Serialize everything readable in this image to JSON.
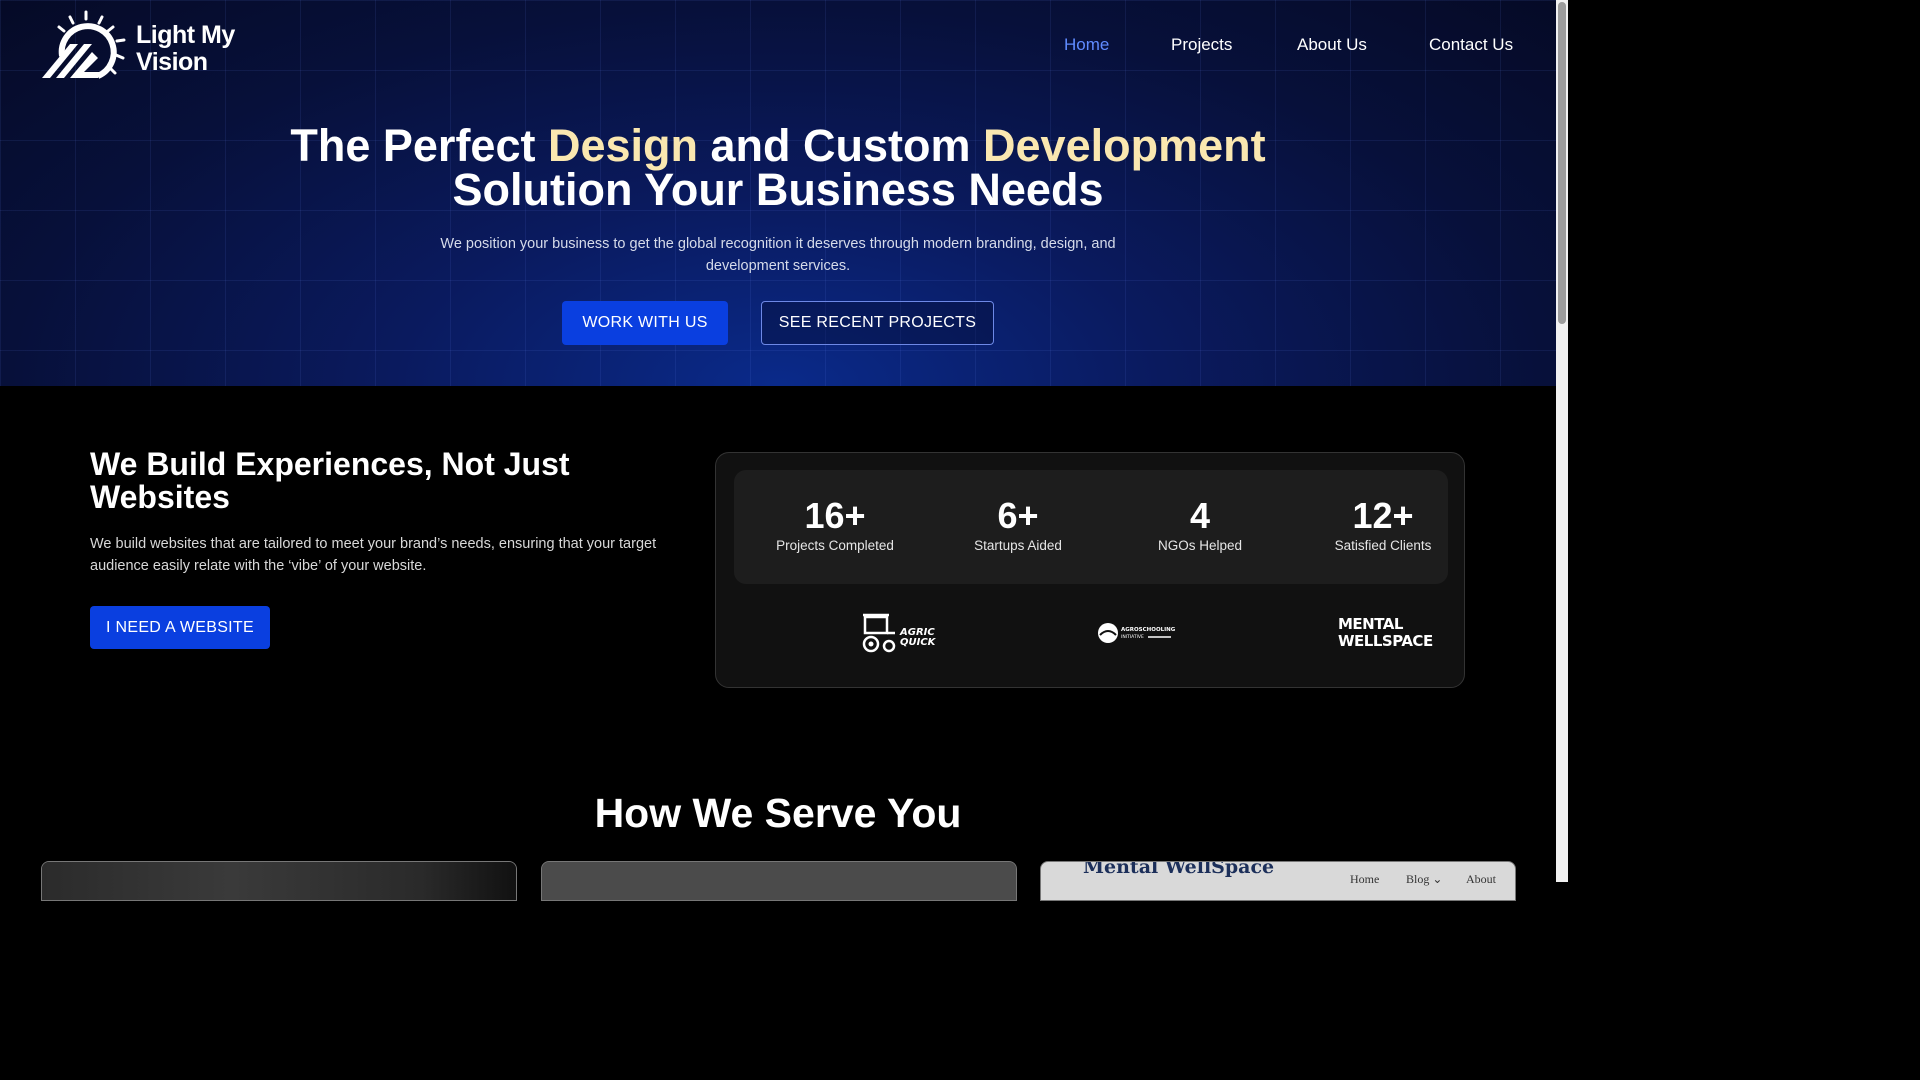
{
  "brand": {
    "line1": "Light My",
    "line2": "Vision"
  },
  "nav": [
    {
      "label": "Home",
      "active": true
    },
    {
      "label": "Projects",
      "active": false
    },
    {
      "label": "About Us",
      "active": false
    },
    {
      "label": "Contact Us",
      "active": false
    }
  ],
  "hero": {
    "title_a": "The Perfect ",
    "title_hl1": "Design",
    "title_b": " and Custom ",
    "title_hl2": "Development",
    "title_line2": "Solution Your Business Needs",
    "subtitle": "We position your business to get the global recognition it deserves through modern branding, design, and development services.",
    "primary_cta": "WORK WITH US",
    "secondary_cta": "SEE RECENT PROJECTS"
  },
  "build": {
    "title": "We Build Experiences, Not Just Websites",
    "text": "We build websites that are tailored to meet your brand’s needs, ensuring that your target audience easily relate with the ‘vibe’ of your website.",
    "cta": "I NEED A WEBSITE"
  },
  "stats": [
    {
      "value": "16+",
      "label": "Projects Completed"
    },
    {
      "value": "6+",
      "label": "Startups Aided"
    },
    {
      "value": "4",
      "label": "NGOs Helped"
    },
    {
      "value": "12+",
      "label": "Satisfied Clients"
    }
  ],
  "partners": {
    "agric_quick": "AGRIC QUICK",
    "agroschooling": "AGROSCHOOLING INITIATIVE",
    "mental_wellspace": "MENTAL WELLSPACE"
  },
  "services": {
    "title": "How We Serve You",
    "card3_title": "Mental WellSpace",
    "card3_nav": [
      "Home",
      "Blog",
      "About"
    ]
  },
  "colors": {
    "accent_blue": "#0a3fe0",
    "nav_active": "#5f8bff",
    "highlight": "#fae7b0"
  }
}
